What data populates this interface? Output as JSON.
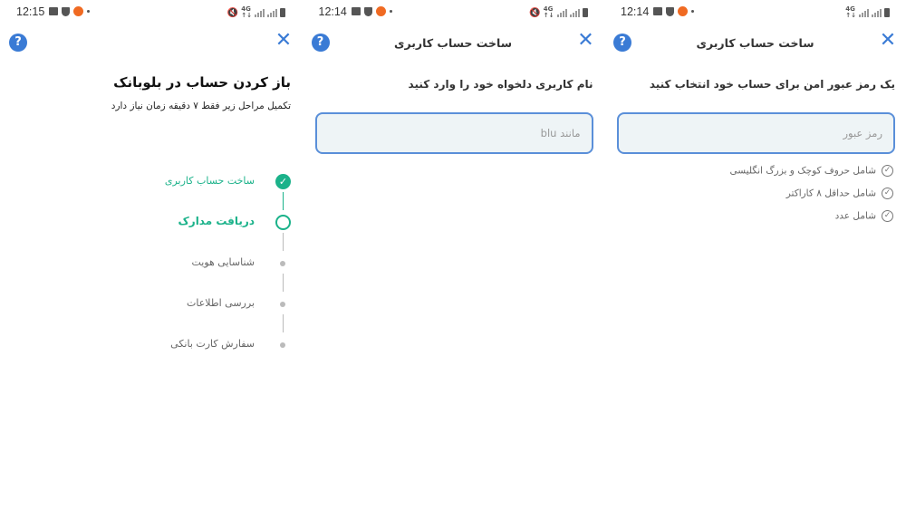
{
  "screens": [
    {
      "status": {
        "time": "12:15"
      },
      "header": {
        "help": "?",
        "close": "✕"
      },
      "title": "باز کردن حساب در بلوبانک",
      "subtitle": "تکمیل مراحل زیر فقط ۷ دقیقه زمان نیاز دارد",
      "steps": [
        {
          "label": "ساخت حساب کاربری",
          "state": "done"
        },
        {
          "label": "دریافت مدارک",
          "state": "active"
        },
        {
          "label": "شناسایی هویت",
          "state": "pending"
        },
        {
          "label": "بررسی اطلاعات",
          "state": "pending"
        },
        {
          "label": "سفارش کارت بانکی",
          "state": "pending"
        }
      ]
    },
    {
      "status": {
        "time": "12:14"
      },
      "header": {
        "title": "ساخت حساب کاربری",
        "help": "?",
        "close": "✕"
      },
      "prompt": "نام کاربری دلخواه خود را وارد کنید",
      "input": {
        "placeholder": "مانند blu",
        "value": ""
      }
    },
    {
      "status": {
        "time": "12:14"
      },
      "header": {
        "title": "ساخت حساب کاربری",
        "help": "?",
        "close": "✕"
      },
      "prompt": "یک رمز عبور امن برای حساب خود انتخاب کنید",
      "input": {
        "placeholder": "رمز عبور",
        "value": ""
      },
      "rules": [
        {
          "label": "شامل حروف کوچک و بزرگ انگلیسی"
        },
        {
          "label": "شامل حداقل ۸ کاراکتر"
        },
        {
          "label": "شامل عدد"
        }
      ]
    }
  ],
  "colors": {
    "accent": "#3a7bd5",
    "success": "#1bb28a",
    "field_bg": "#eef4f6"
  },
  "icons": {
    "help": "question-circle-icon",
    "close": "close-x-icon",
    "step_done": "check-circle-icon",
    "rule": "check-circle-outline-icon"
  }
}
